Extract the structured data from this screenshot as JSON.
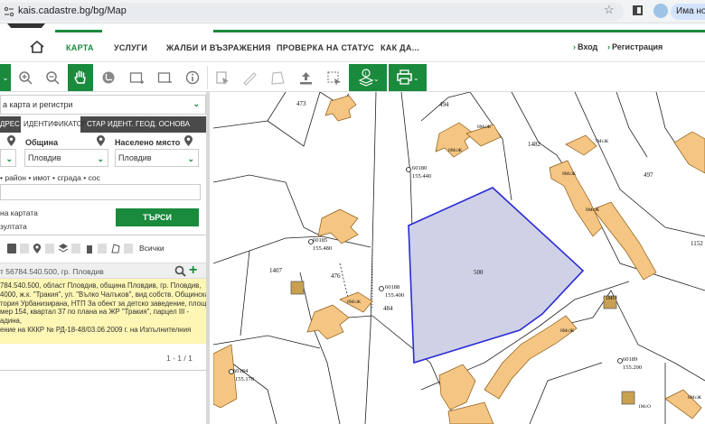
{
  "browser": {
    "url": "kais.cadastre.bg/bg/Map",
    "profile_label": "Има нова"
  },
  "nav": {
    "items": [
      "КАРТА",
      "УСЛУГИ",
      "ЖАЛБИ И ВЪЗРАЖЕНИЯ",
      "ПРОВЕРКА НА СТАТУС",
      "КАК ДА..."
    ],
    "login": "Вход",
    "register": "Регистрация"
  },
  "toolbar": {
    "icons": [
      "zoom-in-icon",
      "zoom-out-icon",
      "pan-hand-icon",
      "globe-icon",
      "add-point-icon",
      "remove-point-icon",
      "info-icon",
      "select-plot-icon",
      "measure-icon",
      "area-icon",
      "upload-icon",
      "select-area-icon",
      "layers-info-icon",
      "print-icon"
    ]
  },
  "panel": {
    "layer_select": "а карта и регистри",
    "tabs": [
      "ДРЕС",
      "ИДЕНТИФИКАТОР",
      "СТАР ИДЕНТ.",
      "ГЕОД. ОСНОВА"
    ],
    "municipality_label": "Община",
    "municipality_value": "Пловдив",
    "settlement_label": "Населено място",
    "settlement_value": "Пловдив",
    "hint": "• район • имот • сграда • сос",
    "checkbox_map": "на картата",
    "checkbox_result": "зултата",
    "search_button": "ТЪРСИ",
    "filter_label": "Всички",
    "result_header": "т 56784.540.500, гр. Пловдив",
    "result_lines": [
      "784.540.500, област Пловдив, община Пловдив, гр. Пловдив,",
      "4000, ж.к. \"Тракия\", ул. \"Вълко Чалъков\", вид собств. Общинска",
      "тория Урбанизирана, НТП За обект за детско заведение, площ",
      "мер 154, квартал 37 по плана на ЖР \"Тракия\", парцел III -",
      "адина,",
      "ение на КККР № РД-18-48/03.06.2009 г. на Изпълнителния"
    ],
    "pager": "1 - 1 / 1"
  },
  "map": {
    "parcel_labels": [
      "473",
      "494",
      "1482",
      "497",
      "1152",
      "1407",
      "476",
      "484",
      "500"
    ],
    "building_labels": [
      "8МсЖ",
      "8МсЖ",
      "7МсЖ",
      "8МсЖ",
      "8МсЖ",
      "8МсЖ",
      "8МсЖ",
      "1МО",
      "1МсО",
      "8МсЖ"
    ],
    "point_labels": [
      "60180",
      "155.440",
      "60185",
      "155.480",
      "60188",
      "155.400",
      "60184",
      "155.170",
      "60189",
      "155.200"
    ]
  }
}
